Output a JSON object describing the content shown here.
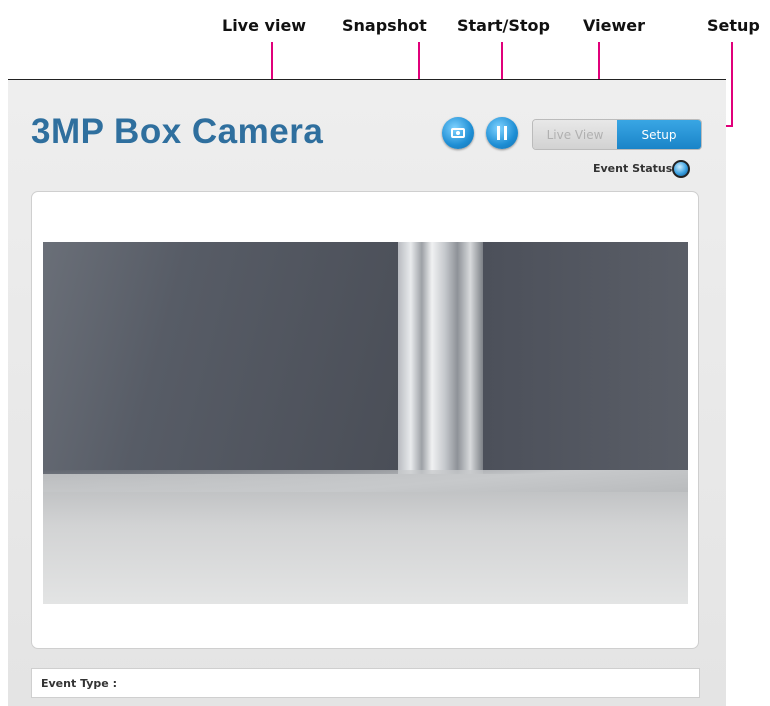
{
  "callouts": {
    "live_view": "Live view",
    "snapshot": "Snapshot",
    "start_stop": "Start/Stop",
    "viewer": "Viewer",
    "setup": "Setup"
  },
  "header": {
    "title": "3MP Box Camera"
  },
  "toolbar": {
    "snapshot_icon": "camera-icon",
    "start_stop_icon": "pause-icon"
  },
  "view_toggle": {
    "live_view_label": "Live View",
    "setup_label": "Setup",
    "active": "Setup"
  },
  "status": {
    "event_status_label": "Event Status :"
  },
  "event_type": {
    "label": "Event Type :"
  },
  "colors": {
    "accent": "#1e8ed4",
    "title": "#2f6f9e",
    "callout_line": "#e0007a"
  }
}
